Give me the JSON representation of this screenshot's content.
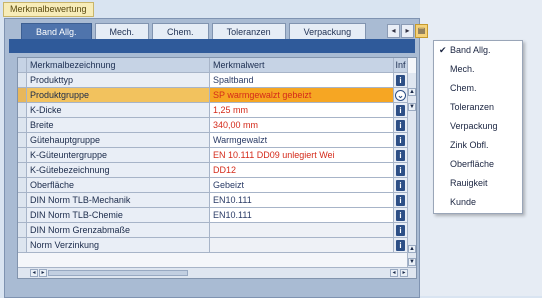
{
  "page_title": "Merkmalbewertung",
  "tabs": [
    {
      "label": "Band Allg.",
      "active": true
    },
    {
      "label": "Mech."
    },
    {
      "label": "Chem."
    },
    {
      "label": "Toleranzen"
    },
    {
      "label": "Verpackung"
    }
  ],
  "tab_nav": {
    "prev": "◂",
    "next": "▸",
    "menu": "▤"
  },
  "table": {
    "headers": {
      "name": "Merkmalbezeichnung",
      "value": "Merkmalwert",
      "info": "Inf"
    },
    "rows": [
      {
        "name": "Produkttyp",
        "value": "Spaltband"
      },
      {
        "name": "Produktgruppe",
        "value": "SP warmgewalzt gebeizt",
        "selected": true
      },
      {
        "name": "K-Dicke",
        "value": "1,25 mm"
      },
      {
        "name": "Breite",
        "value": "340,00 mm"
      },
      {
        "name": "Güte­hauptgruppe",
        "value": "Warmgewalzt"
      },
      {
        "name": "K-Güteuntergruppe",
        "value": "EN 10.111 DD09  unlegiert Wei"
      },
      {
        "name": "K-Gütebezeichnung",
        "value": "DD12"
      },
      {
        "name": "Oberfläche",
        "value": "Gebeizt"
      },
      {
        "name": "DIN Norm TLB-Mechanik",
        "value": "EN10.111"
      },
      {
        "name": "DIN Norm TLB-Chemie",
        "value": "EN10.111"
      },
      {
        "name": "DIN Norm Grenzabmaße",
        "value": ""
      },
      {
        "name": "Norm Verzinkung",
        "value": ""
      }
    ]
  },
  "colors": {
    "red_value": "#d42a1a",
    "dark_value": "#2a3b66",
    "selected_bg": "#f6a623"
  },
  "menu": {
    "items": [
      {
        "label": "Band Allg.",
        "checked": true
      },
      {
        "label": "Mech."
      },
      {
        "label": "Chem."
      },
      {
        "label": "Toleranzen"
      },
      {
        "label": "Verpackung"
      },
      {
        "label": "Zink Obfl."
      },
      {
        "label": "Oberfläche"
      },
      {
        "label": "Rauigkeit"
      },
      {
        "label": "Kunde"
      }
    ]
  }
}
